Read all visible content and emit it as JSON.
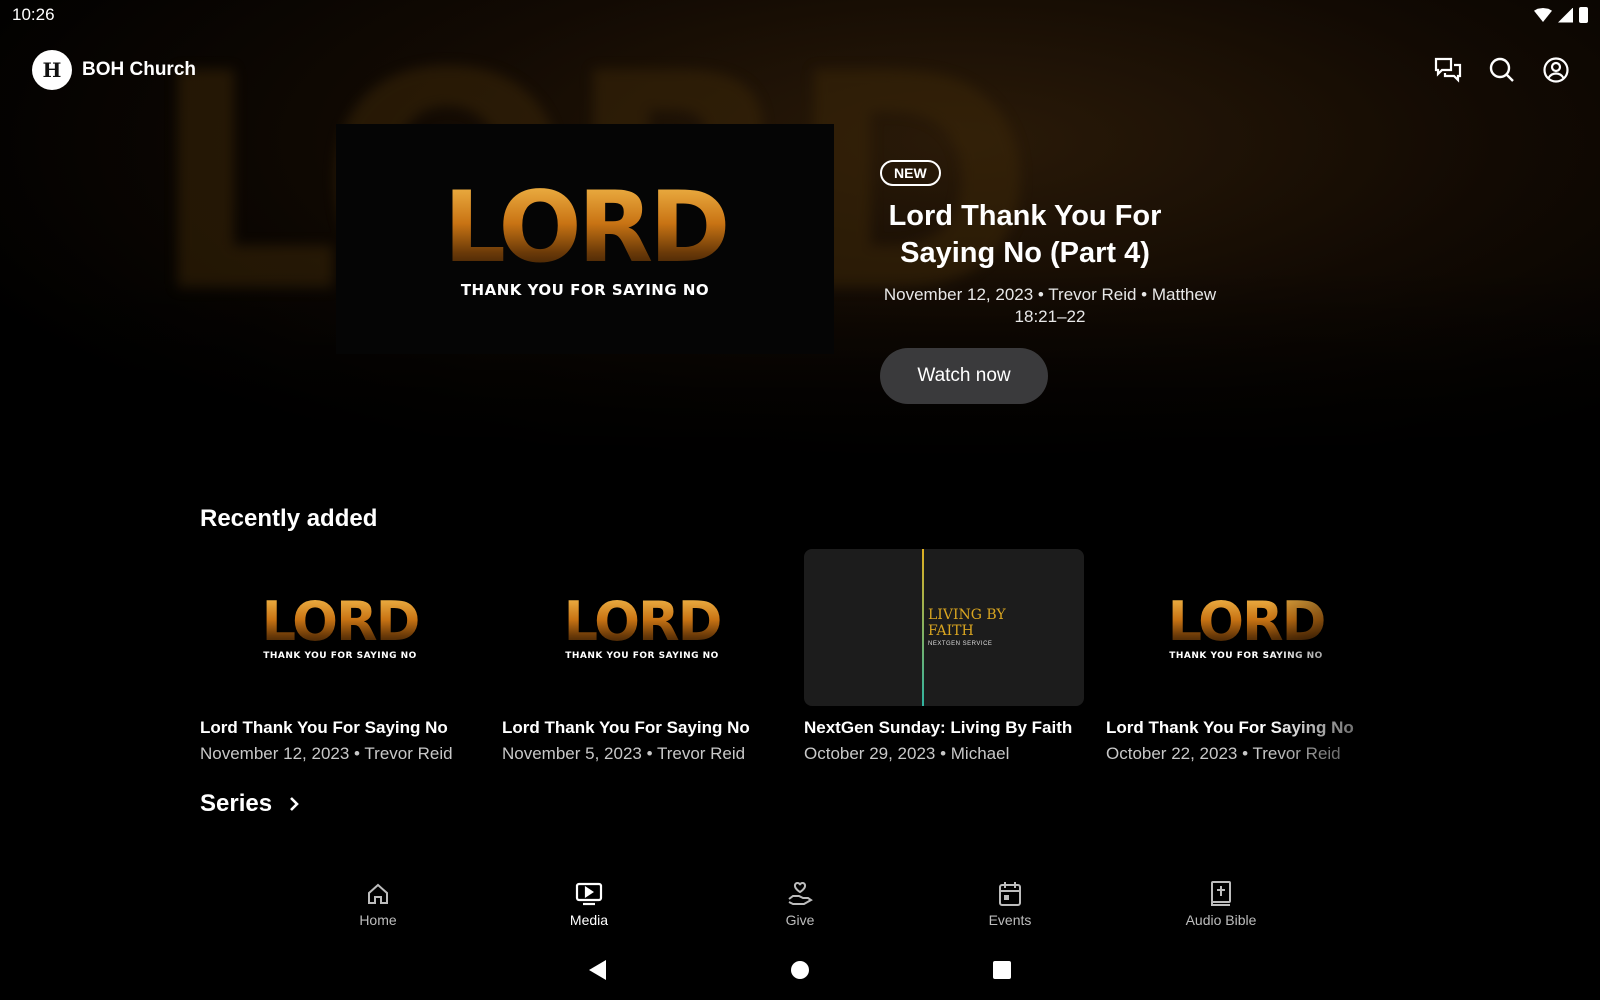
{
  "status_bar": {
    "time": "10:26"
  },
  "header": {
    "brand_name": "BOH Church",
    "logo_glyph": "H"
  },
  "icons": {
    "chat": "chat-icon",
    "search": "search-icon",
    "profile": "account-icon"
  },
  "hero": {
    "badge": "NEW",
    "title": "Lord Thank You For Saying No (Part 4)",
    "meta": "November 12, 2023 • Trevor Reid • Matthew 18:21–22",
    "button": "Watch now",
    "art_word": "LORD",
    "art_tagline": "THANK YOU FOR SAYING NO"
  },
  "recent": {
    "title": "Recently added",
    "items": [
      {
        "title": "Lord Thank You For Saying No",
        "meta": "November 12, 2023 • Trevor Reid",
        "art_word": "LORD",
        "art_tagline": "THANK YOU FOR SAYING NO"
      },
      {
        "title": "Lord Thank You For Saying No",
        "meta": "November 5, 2023 • Trevor Reid",
        "art_word": "LORD",
        "art_tagline": "THANK YOU FOR SAYING NO"
      },
      {
        "title": "NextGen Sunday: Living By Faith",
        "meta": "October 29, 2023 • Michael",
        "art_line1": "LIVING BY",
        "art_line2": "FAITH",
        "art_sub": "NEXTGEN SERVICE"
      },
      {
        "title": "Lord Thank You For Saying No",
        "meta": "October 22, 2023 • Trevor Reid",
        "art_word": "LORD",
        "art_tagline": "THANK YOU FOR SAYING NO"
      }
    ]
  },
  "series": {
    "title": "Series"
  },
  "nav": {
    "items": [
      {
        "label": "Home",
        "icon": "home-icon"
      },
      {
        "label": "Media",
        "icon": "media-icon",
        "active": true
      },
      {
        "label": "Give",
        "icon": "give-icon"
      },
      {
        "label": "Events",
        "icon": "calendar-icon"
      },
      {
        "label": "Audio Bible",
        "icon": "bible-icon"
      }
    ]
  },
  "colors": {
    "accent_gold": "#c97414",
    "button_bg": "#3a3a3c",
    "bg": "#000000"
  }
}
